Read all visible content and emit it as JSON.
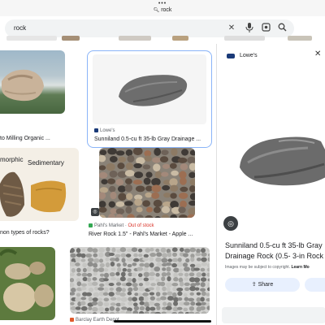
{
  "browser": {
    "menu_dots": "•••",
    "url_text": "rock"
  },
  "search": {
    "query": "rock"
  },
  "results": [
    {
      "caption": "to Milling Organic ...",
      "source": ""
    },
    {
      "caption": "Sunniland 0.5-cu ft 35-lb Gray Drainage ...",
      "source": "Lowe's"
    },
    {
      "caption": "non types of rocks?",
      "source": "",
      "overlay_left": "morphic",
      "overlay_right": "Sedimentary"
    },
    {
      "caption": "River Rock 1.5\" - Pahl's Market - Apple ...",
      "source": "Pahl's Market",
      "stock": "Out of stock"
    },
    {
      "caption": "",
      "source": ""
    },
    {
      "caption": "",
      "source": "Barclay Earth Depot"
    }
  ],
  "panel": {
    "source": "Lowe's",
    "title_line1": "Sunniland 0.5-cu ft 35-lb Gray",
    "title_line2": "Drainage Rock (0.5- 3-in Rock S",
    "copyright": "Images may be subject to copyright.",
    "learn_more": "Learn Mo",
    "share_label": "Share"
  },
  "colors": {
    "accent_blue": "#1a73e8",
    "lowes_blue": "#1a3a78",
    "out_of_stock": "#d93025",
    "pahls_green": "#34a853"
  },
  "icons": {
    "clear": "close-icon",
    "voice": "mic-icon",
    "lens": "lens-icon",
    "search": "search-icon",
    "share": "share-icon",
    "close_panel": "close-icon"
  }
}
